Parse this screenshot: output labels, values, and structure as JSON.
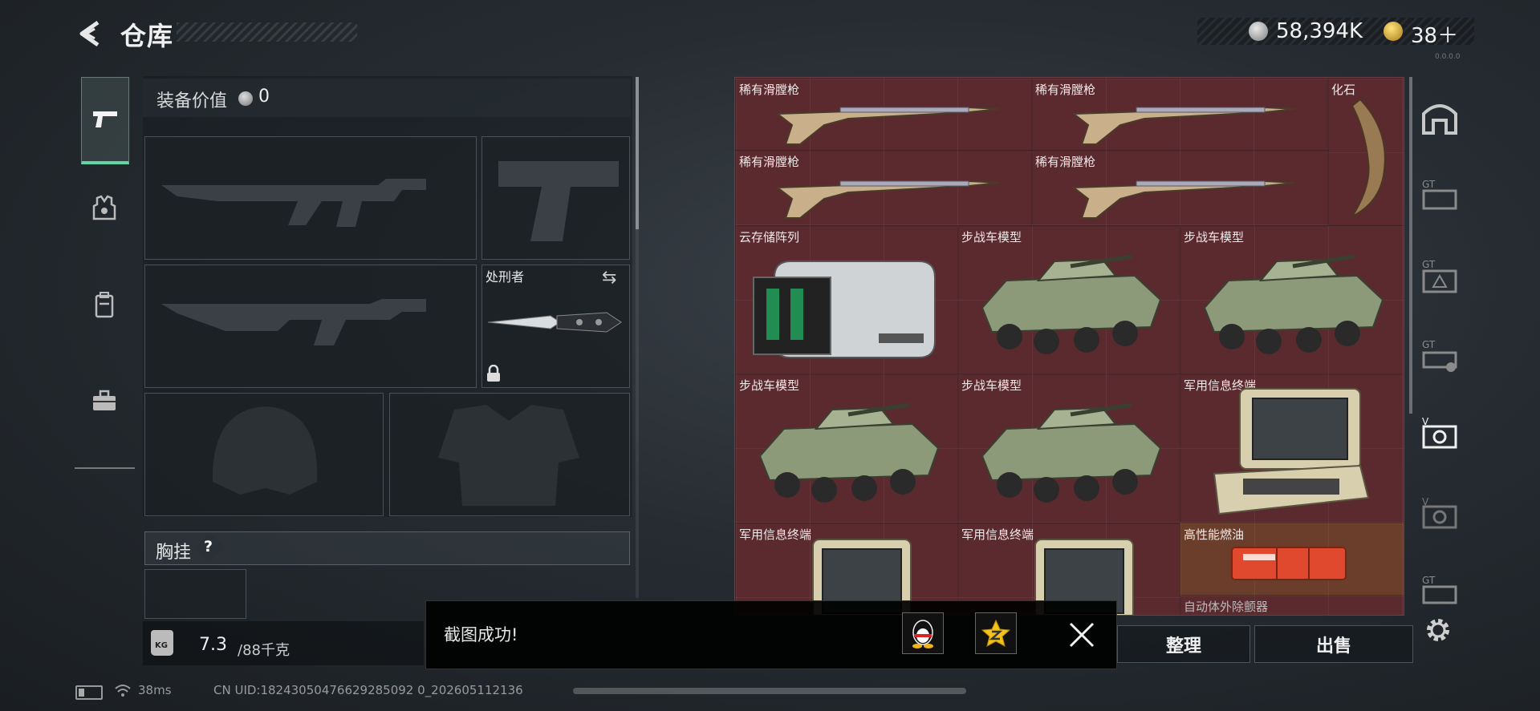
{
  "header": {
    "title": "仓库",
    "silver_value": "58,394K",
    "gold_value": "38＋",
    "version": "0.0.0.0"
  },
  "equipment": {
    "value_label": "装备价值",
    "value": "0",
    "melee_label": "处刑者",
    "rig_label": "胸挂",
    "rig_help": "?",
    "weight_value": "7.3",
    "weight_max": "/88千克",
    "kg_icon_text": "KG"
  },
  "stash": {
    "items": [
      {
        "label": "稀有滑膛枪",
        "icon": "musket-icon"
      },
      {
        "label": "稀有滑膛枪",
        "icon": "musket-icon"
      },
      {
        "label": "化石",
        "icon": "fossil-claw-icon"
      },
      {
        "label": "稀有滑膛枪",
        "icon": "musket-icon"
      },
      {
        "label": "稀有滑膛枪",
        "icon": "musket-icon"
      },
      {
        "label": "云存储阵列",
        "icon": "storage-array-icon"
      },
      {
        "label": "步战车模型",
        "icon": "ifv-model-icon"
      },
      {
        "label": "步战车模型",
        "icon": "ifv-model-icon"
      },
      {
        "label": "步战车模型",
        "icon": "ifv-model-icon"
      },
      {
        "label": "步战车模型",
        "icon": "ifv-model-icon"
      },
      {
        "label": "军用信息终端",
        "icon": "military-terminal-icon"
      },
      {
        "label": "军用信息终端",
        "icon": "military-terminal-icon"
      },
      {
        "label": "军用信息终端",
        "icon": "military-terminal-icon"
      },
      {
        "label": "高性能燃油",
        "icon": "fuel-case-icon"
      },
      {
        "label": "自动体外除颤器",
        "icon": "defibrillator-icon"
      }
    ]
  },
  "actions": {
    "arrange": "整理",
    "sell": "出售"
  },
  "toast": {
    "message": "截图成功!"
  },
  "status": {
    "ping": "38ms",
    "uid": "CN UID:18243050476629285092 0_202605112136"
  },
  "colors": {
    "accent": "#5fd6a6",
    "stash_bg": "#5b2a2f"
  }
}
